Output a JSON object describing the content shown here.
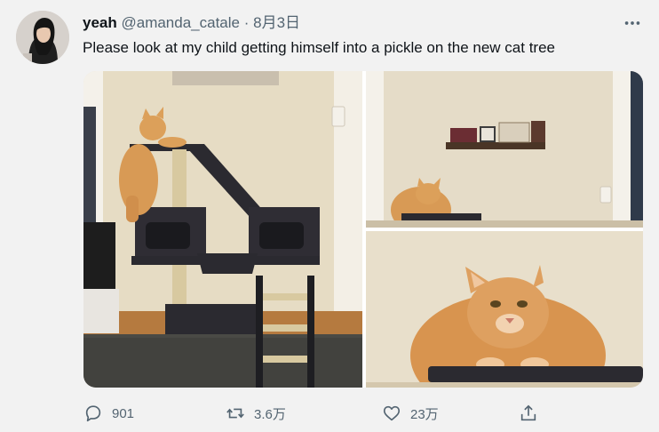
{
  "tweet": {
    "display_name": "yeah",
    "handle": "@amanda_catale",
    "separator": "·",
    "date": "8月3日",
    "more_icon": "more-horizontal-icon",
    "text": "Please look at my child getting himself into a pickle on the new cat tree"
  },
  "actions": {
    "reply_count": "901",
    "retweet_count": "3.6万",
    "like_count": "23万"
  },
  "colors": {
    "background": "#f2f2f2",
    "text": "#0f1419",
    "secondary": "#536471"
  }
}
